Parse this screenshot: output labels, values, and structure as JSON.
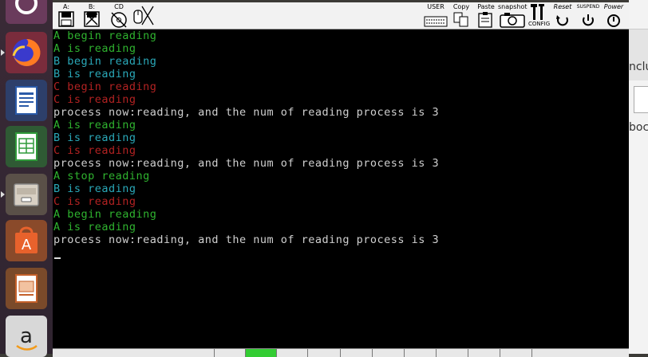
{
  "launcher": {
    "apps": [
      {
        "name": "ubuntu-dash-icon"
      },
      {
        "name": "firefox-icon"
      },
      {
        "name": "libreoffice-writer-icon"
      },
      {
        "name": "libreoffice-calc-icon"
      },
      {
        "name": "file-manager-icon"
      },
      {
        "name": "software-center-icon"
      },
      {
        "name": "libreoffice-impress-icon"
      },
      {
        "name": "amazon-icon"
      }
    ]
  },
  "toolbar": {
    "floppy_a": "A:",
    "floppy_b": "B:",
    "cdrom": "CD",
    "user": "USER",
    "copy": "Copy",
    "paste": "Paste",
    "snapshot": "snapshot",
    "config": "CONFIG",
    "reset": "Reset",
    "suspend": "SUSPEND",
    "power": "Power"
  },
  "console": {
    "lines": [
      {
        "text": "A begin reading",
        "color": "#2fb32f"
      },
      {
        "text": "A is reading",
        "color": "#2fb32f"
      },
      {
        "text": "B begin reading",
        "color": "#2aa8b8"
      },
      {
        "text": "B is reading",
        "color": "#2aa8b8"
      },
      {
        "text": "C begin reading",
        "color": "#b22222"
      },
      {
        "text": "C is reading",
        "color": "#b22222"
      },
      {
        "text": "process now:reading, and the num of reading process is 3",
        "color": "#d0d0d0"
      },
      {
        "text": "A is reading",
        "color": "#2fb32f"
      },
      {
        "text": "B is reading",
        "color": "#2aa8b8"
      },
      {
        "text": "C is reading",
        "color": "#b22222"
      },
      {
        "text": "process now:reading, and the num of reading process is 3",
        "color": "#d0d0d0"
      },
      {
        "text": "A stop reading",
        "color": "#2fb32f"
      },
      {
        "text": "B is reading",
        "color": "#2aa8b8"
      },
      {
        "text": "C is reading",
        "color": "#b22222"
      },
      {
        "text": "A begin reading",
        "color": "#2fb32f"
      },
      {
        "text": "A is reading",
        "color": "#2fb32f"
      },
      {
        "text": "process now:reading, and the num of reading process is 3",
        "color": "#d0d0d0"
      }
    ]
  },
  "background_window": {
    "text1": "nclu",
    "text2": "boch"
  },
  "colors": {
    "console_bg": "#000000",
    "green": "#2fb32f",
    "cyan": "#2aa8b8",
    "red": "#b22222",
    "grey": "#d0d0d0",
    "status_highlight": "#33cc33"
  }
}
